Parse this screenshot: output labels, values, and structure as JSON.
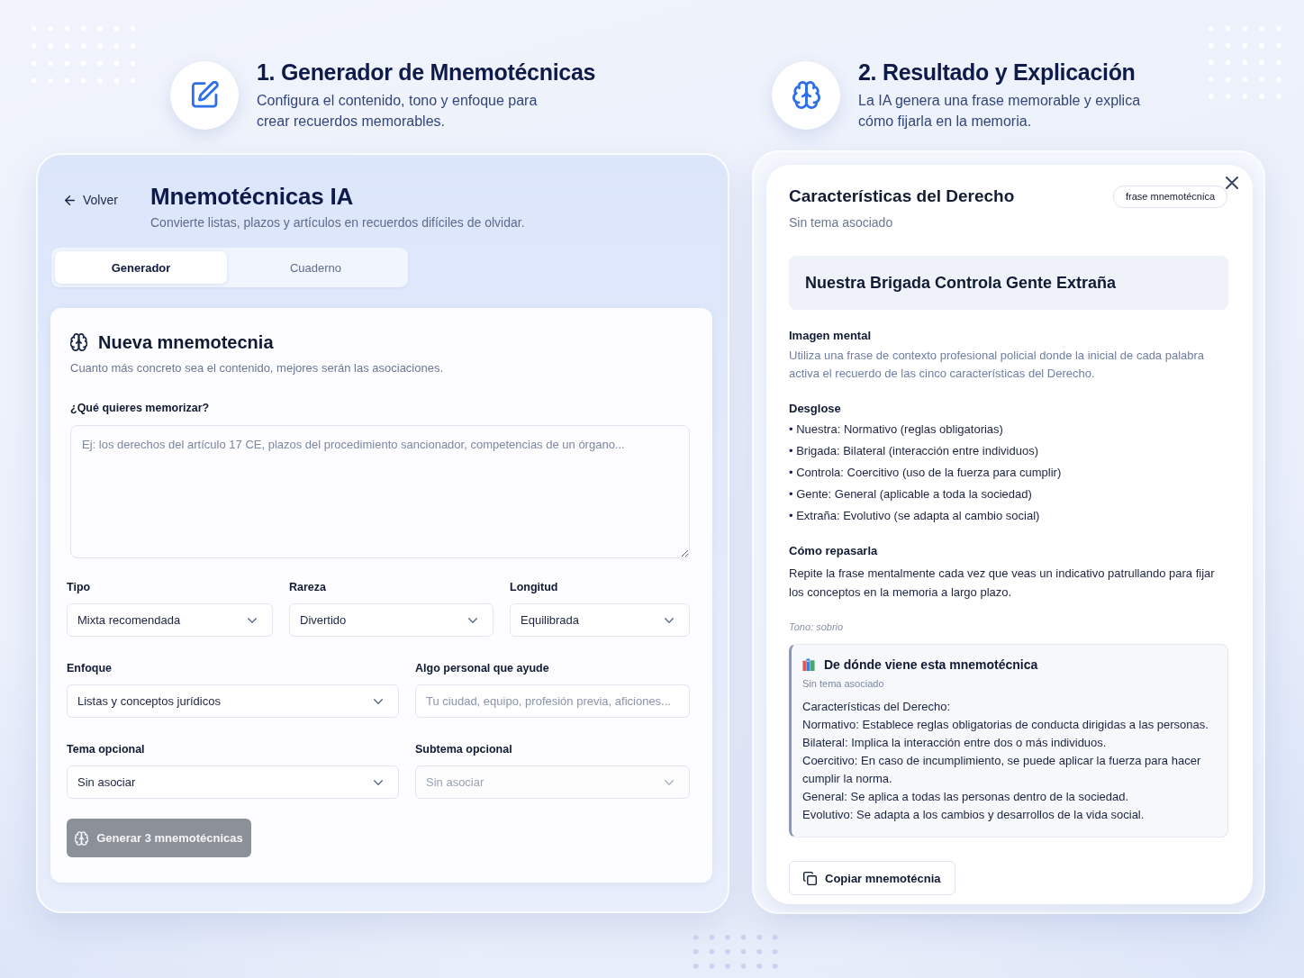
{
  "steps": [
    {
      "kind": "configure",
      "title": "1. Generador de Mnemotécnicas",
      "description": "Configura el contenido, tono y enfoque para crear recuerdos memorables."
    },
    {
      "kind": "result",
      "title": "2. Resultado y Explicación",
      "description": "La IA genera una frase memorable y explica cómo fijarla en la memoria."
    }
  ],
  "generator": {
    "back_link": "Volver",
    "title": "Mnemotécnicas IA",
    "subtitle": "Convierte listas, plazos y artículos en recuerdos difíciles de olvidar.",
    "tabs": [
      {
        "label": "Generador",
        "selected": true
      },
      {
        "label": "Cuaderno",
        "selected": false
      }
    ],
    "form": {
      "title": "Nueva mnemotecnia",
      "hint": "Cuanto más concreto sea el contenido, mejores serán las asociaciones.",
      "content": {
        "label": "¿Qué quieres memorizar?",
        "placeholder": "Ej: los derechos del artículo 17 CE, plazos del procedimiento sancionador, competencias de un órgano..."
      },
      "rows": [
        {
          "fields": [
            {
              "kind": "select",
              "label": "Tipo",
              "value": "Mixta recomendada",
              "disabled": false
            },
            {
              "kind": "select",
              "label": "Rareza",
              "value": "Divertido",
              "disabled": false
            },
            {
              "kind": "select",
              "label": "Longitud",
              "value": "Equilibrada",
              "disabled": false
            }
          ]
        },
        {
          "fields": [
            {
              "kind": "select",
              "label": "Enfoque",
              "value": "Listas y conceptos jurídicos",
              "disabled": false
            },
            {
              "kind": "text",
              "label": "Algo personal que ayude",
              "placeholder": "Tu ciudad, equipo, profesión previa, aficiones...",
              "disabled": false
            }
          ]
        },
        {
          "fields": [
            {
              "kind": "select",
              "label": "Tema opcional",
              "value": "Sin asociar",
              "disabled": false
            },
            {
              "kind": "select",
              "label": "Subtema opcional",
              "value": "Sin asociar",
              "disabled": true
            }
          ]
        }
      ],
      "submit_button": {
        "label": "Generar 3 mnemotécnicas",
        "disabled": true
      }
    }
  },
  "result": {
    "title": "Características del Derecho",
    "badge": "frase mnemotécnica",
    "topic": "Sin tema asociado",
    "phrase": "Nuestra Brigada Controla Gente Extraña",
    "mental_image": {
      "heading": "Imagen mental",
      "text": "Utiliza una frase de contexto profesional policial donde la inicial de cada palabra activa el recuerdo de las cinco características del Derecho."
    },
    "breakdown": {
      "heading": "Desglose",
      "items": [
        "• Nuestra: Normativo (reglas obligatorias)",
        "• Brigada: Bilateral (interacción entre individuos)",
        "• Controla: Coercitivo (uso de la fuerza para cumplir)",
        "• Gente: General (aplicable a toda la sociedad)",
        "• Extraña: Evolutivo (se adapta al cambio social)"
      ]
    },
    "review": {
      "heading": "Cómo repasarla",
      "text": "Repite la frase mentalmente cada vez que veas un indicativo patrullando para fijar los conceptos en la memoria a largo plazo."
    },
    "tone": "Tono: sobrio",
    "source": {
      "title": "De dónde viene esta mnemotécnica",
      "topic": "Sin tema asociado",
      "lines": [
        "Características del Derecho:",
        "Normativo: Establece reglas obligatorias de conducta dirigidas a las personas.",
        "Bilateral: Implica la interacción entre dos o más individuos.",
        "Coercitivo: En caso de incumplimiento, se puede aplicar la fuerza para hacer cumplir la norma.",
        "General: Se aplica a todas las personas dentro de la sociedad.",
        "Evolutivo: Se adapta a los cambios y desarrollos de la vida social."
      ]
    },
    "copy_button": "Copiar mnemotécnia"
  }
}
